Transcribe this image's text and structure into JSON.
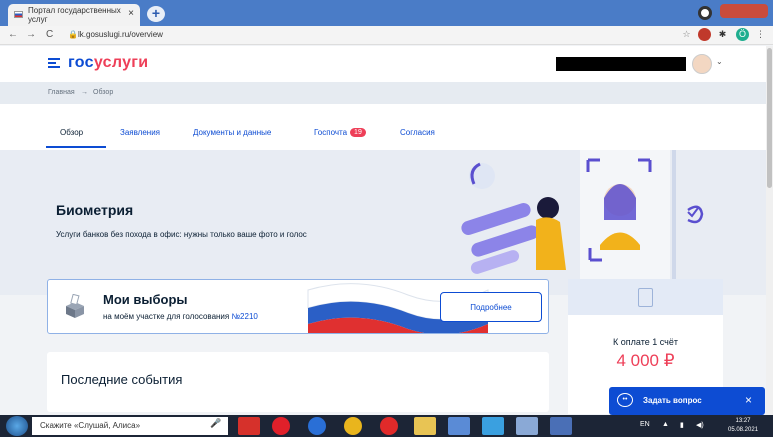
{
  "browser": {
    "tab_title": "Портал государственных услуг",
    "tab_close": "×",
    "new_tab": "+",
    "url": "lk.gosuslugi.ru/overview",
    "nav_back": "←",
    "nav_forward": "→",
    "nav_reload": "C"
  },
  "header": {
    "logo_part1": "гос",
    "logo_part2": "услуги"
  },
  "breadcrumb": {
    "home": "Главная",
    "separator": "→",
    "current": "Обзор"
  },
  "tabs": [
    {
      "label": "Обзор"
    },
    {
      "label": "Заявления"
    },
    {
      "label": "Документы и данные"
    },
    {
      "label": "Госпочта",
      "badge": "19"
    },
    {
      "label": "Согласия"
    }
  ],
  "banner": {
    "title": "Биометрия",
    "subtitle": "Услуги банков без похода в офис: нужны только ваше фото и голос"
  },
  "elections": {
    "title": "Мои выборы",
    "subtitle": "на моём участке для голосования ",
    "precinct": "№2210",
    "button": "Подробнее"
  },
  "payment": {
    "label": "К оплате 1 счёт",
    "amount": "4 000 ₽"
  },
  "events": {
    "title": "Последние события"
  },
  "chat": {
    "label": "Задать вопрос",
    "close": "×"
  },
  "taskbar": {
    "search_placeholder": "Скажите «Слушай, Алиса»",
    "lang": "EN",
    "time": "13:27",
    "date": "05.08.2021"
  },
  "colors": {
    "brand_blue": "#0d4cd3",
    "brand_red": "#ee3f58",
    "tabbar": "#4a7cc7"
  }
}
